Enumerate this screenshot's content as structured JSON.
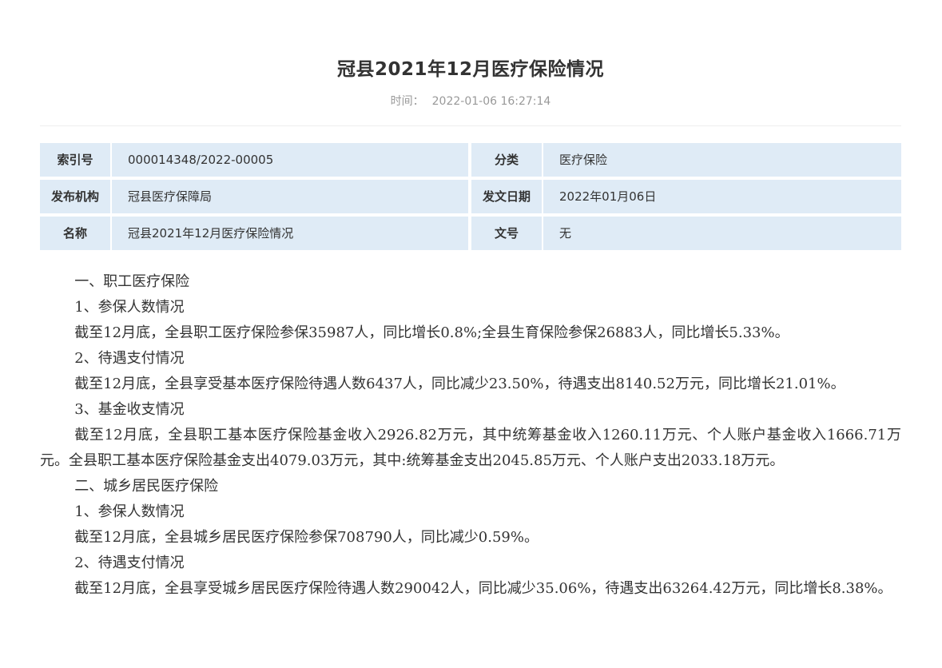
{
  "article": {
    "title": "冠县2021年12月医疗保险情况",
    "time_label": "时间：",
    "time_value": "2022-01-06 16:27:14"
  },
  "info": {
    "rows": [
      {
        "k1": "索引号",
        "v1": "000014348/2022-00005",
        "k2": "分类",
        "v2": "医疗保险"
      },
      {
        "k1": "发布机构",
        "v1": "冠县医疗保障局",
        "k2": "发文日期",
        "v2": "2022年01月06日"
      },
      {
        "k1": "名称",
        "v1": "冠县2021年12月医疗保险情况",
        "k2": "文号",
        "v2": "无"
      }
    ]
  },
  "body": {
    "paragraphs": [
      "一、职工医疗保险",
      "1、参保人数情况",
      "截至12月底，全县职工医疗保险参保35987人，同比增长0.8%;全县生育保险参保26883人，同比增长5.33%。",
      "2、待遇支付情况",
      "截至12月底，全县享受基本医疗保险待遇人数6437人，同比减少23.50%，待遇支出8140.52万元，同比增长21.01%。",
      "3、基金收支情况",
      "截至12月底，全县职工基本医疗保险基金收入2926.82万元，其中统筹基金收入1260.11万元、个人账户基金收入1666.71万元。全县职工基本医疗保险基金支出4079.03万元，其中:统筹基金支出2045.85万元、个人账户支出2033.18万元。",
      "二、城乡居民医疗保险",
      "1、参保人数情况",
      "截至12月底，全县城乡居民医疗保险参保708790人，同比减少0.59%。",
      "2、待遇支付情况",
      "截至12月底，全县享受城乡居民医疗保险待遇人数290042人，同比减少35.06%，待遇支出63264.42万元，同比增长8.38%。"
    ]
  }
}
